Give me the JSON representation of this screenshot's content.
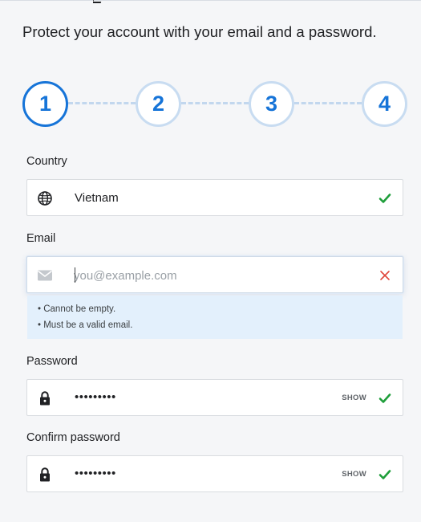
{
  "subtitle": "Protect your account with your email and a password.",
  "steps": [
    {
      "label": "1",
      "active": true
    },
    {
      "label": "2",
      "active": false
    },
    {
      "label": "3",
      "active": false
    },
    {
      "label": "4",
      "active": false
    }
  ],
  "country": {
    "label": "Country",
    "value": "Vietnam",
    "status": "valid"
  },
  "email": {
    "label": "Email",
    "value": "",
    "placeholder": "you@example.com",
    "status": "invalid",
    "errors": [
      "• Cannot be empty.",
      "• Must be a valid email."
    ]
  },
  "password": {
    "label": "Password",
    "masked_value": "•••••••••",
    "toggle_label": "SHOW",
    "status": "valid"
  },
  "confirm_password": {
    "label": "Confirm password",
    "masked_value": "•••••••••",
    "toggle_label": "SHOW",
    "status": "valid"
  },
  "colors": {
    "accent": "#1674d8",
    "step_inactive_border": "#c8dcf1",
    "valid": "#1e9e3a",
    "invalid": "#e0463b",
    "error_bg": "#e3f0fc"
  },
  "icons": {
    "country": "globe-icon",
    "email": "envelope-icon",
    "password": "lock-icon",
    "valid": "check-icon",
    "invalid": "close-icon"
  }
}
